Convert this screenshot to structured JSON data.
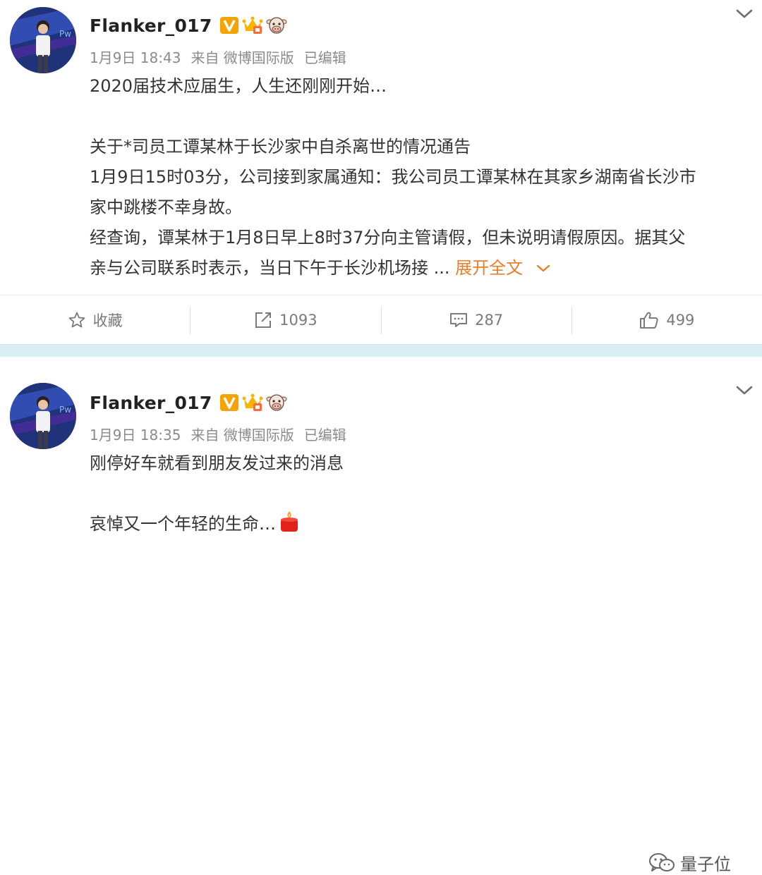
{
  "posts": [
    {
      "username": "Flanker_017",
      "time": "1月9日 18:43",
      "source": "来自 微博国际版",
      "edited": "已编辑",
      "lines": [
        "2020届技术应届生，人生还刚刚开始…",
        "",
        "关于*司员工谭某林于长沙家中自杀离世的情况通告",
        "1月9日15时03分，公司接到家属通知：我公司员工谭某林在其家乡湖南省长沙市",
        "家中跳楼不幸身故。",
        "经查询，谭某林于1月8日早上8时37分向主管请假，但未说明请假原因。据其父",
        "亲与公司联系时表示，当日下午于长沙机场接 ..."
      ],
      "expand_label": "展开全文",
      "actions": {
        "favorite": "收藏",
        "repost": "1093",
        "comment": "287",
        "like": "499"
      }
    },
    {
      "username": "Flanker_017",
      "time": "1月9日 18:35",
      "source": "来自 微博国际版",
      "edited": "已编辑",
      "lines": [
        "刚停好车就看到朋友发过来的消息",
        "",
        "哀悼又一个年轻的生命…"
      ]
    }
  ],
  "watermark": "量子位",
  "icons": [
    "verified-v-icon",
    "crown-vip-icon",
    "cow-icon",
    "chevron-down-icon",
    "star-icon",
    "repost-icon",
    "comment-icon",
    "thumbs-up-icon",
    "candle-emoji-icon",
    "wechat-icon"
  ],
  "colors": {
    "accent": "#ec7e2b",
    "separator": "#d9eff3",
    "meta_text": "#8a8a8a",
    "verified": "#f5a300"
  }
}
